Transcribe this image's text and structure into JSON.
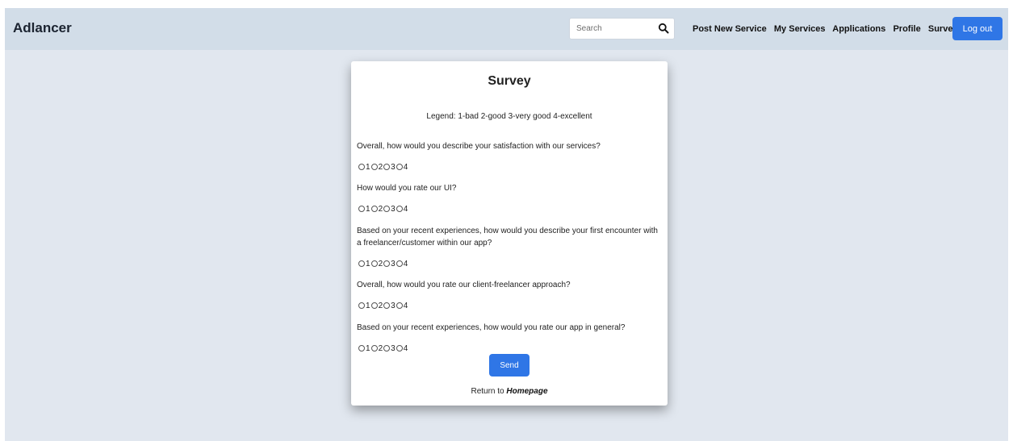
{
  "navbar": {
    "brand": "Adlancer",
    "search_placeholder": "Search",
    "search_icon": "search-icon",
    "links": [
      "Post New Service",
      "My Services",
      "Applications",
      "Profile",
      "Survey"
    ],
    "logout_label": "Log out",
    "accent_color": "#2f76e6"
  },
  "survey": {
    "title": "Survey",
    "legend": "Legend: 1-bad 2-good 3-very good 4-excellent",
    "questions": [
      {
        "text": "Overall, how would you describe your satisfaction with our services?",
        "options": [
          "1",
          "2",
          "3",
          "4"
        ]
      },
      {
        "text": "How would you rate our UI?",
        "options": [
          "1",
          "2",
          "3",
          "4"
        ]
      },
      {
        "text": "Based on your recent experiences, how would you describe your first encounter with a freelancer/customer within our app?",
        "options": [
          "1",
          "2",
          "3",
          "4"
        ]
      },
      {
        "text": "Overall, how would you rate our client-freelancer approach?",
        "options": [
          "1",
          "2",
          "3",
          "4"
        ]
      },
      {
        "text": "Based on your recent experiences, how would you rate our app in general?",
        "options": [
          "1",
          "2",
          "3",
          "4"
        ]
      }
    ],
    "send_label": "Send",
    "return_prefix": "Return to",
    "return_link": "Homepage"
  }
}
